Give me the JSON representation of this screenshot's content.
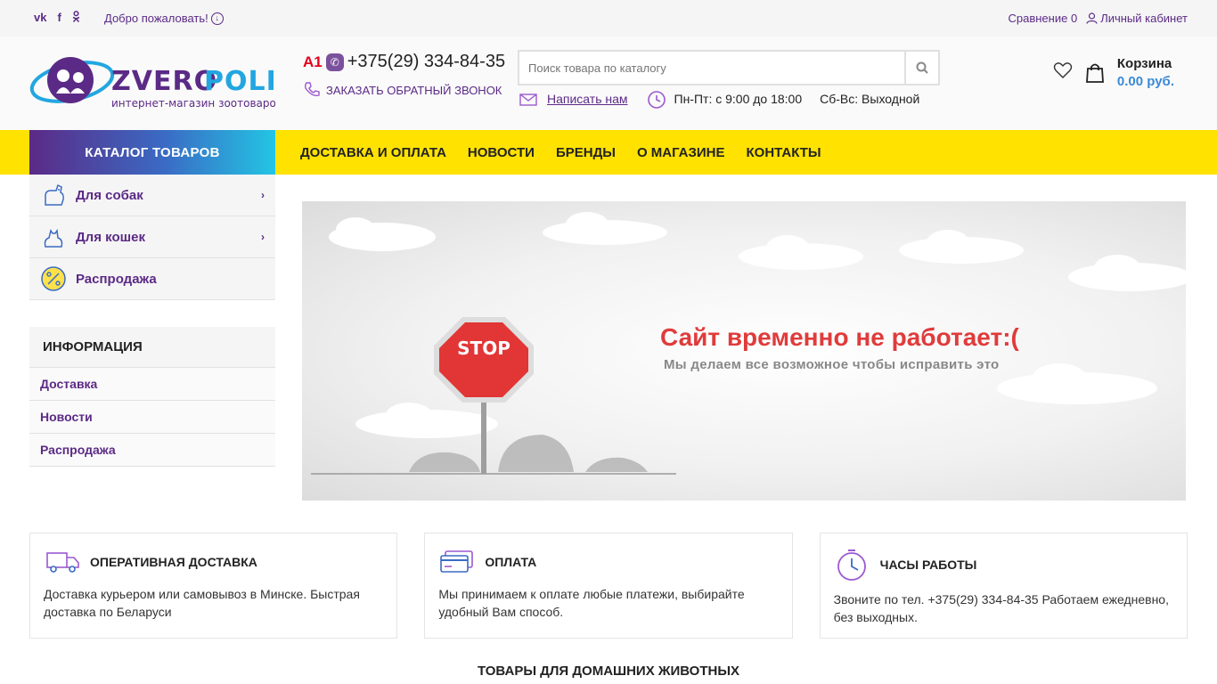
{
  "topbar": {
    "social": [
      "vk",
      "f",
      "ok"
    ],
    "welcome": "Добро пожаловать!",
    "compare": "Сравнение 0",
    "account": "Личный кабинет"
  },
  "header": {
    "logo_text": "ZVEROPOLIS",
    "logo_tagline": "интернет-магазин зоотоваров",
    "phone_prefix": "A1",
    "phone": "+375(29) 334-84-35",
    "callback": "Заказать обратный звонок",
    "search_placeholder": "Поиск товара по каталогу",
    "write_us": "Написать нам",
    "hours_weekdays": "Пн-Пт: с 9:00 до 18:00",
    "hours_weekend": "Сб-Вс: Выходной",
    "cart_title": "Корзина",
    "cart_sum": "0.00 руб."
  },
  "nav": {
    "catalog": "КАТАЛОГ ТОВАРОВ",
    "links": [
      "ДОСТАВКА И ОПЛАТА",
      "НОВОСТИ",
      "БРЕНДЫ",
      "О МАГАЗИНЕ",
      "КОНТАКТЫ"
    ]
  },
  "sidebar": {
    "categories": [
      {
        "label": "Для собак",
        "icon": "dog-icon"
      },
      {
        "label": "Для кошек",
        "icon": "cat-icon"
      },
      {
        "label": "Распродажа",
        "icon": "percent-icon"
      }
    ],
    "info_title": "ИНФОРМАЦИЯ",
    "info_items": [
      "Доставка",
      "Новости",
      "Распродажа"
    ]
  },
  "banner": {
    "stop": "STOP",
    "title": "Сайт временно не работает:(",
    "subtitle": "Мы делаем все возможное чтобы исправить это"
  },
  "features": [
    {
      "title": "ОПЕРАТИВНАЯ ДОСТАВКА",
      "text": "Доставка курьером или самовывоз в Минске. Быстрая доставка по Беларуси",
      "icon": "truck-icon"
    },
    {
      "title": "ОПЛАТА",
      "text": "Мы принимаем к оплате любые платежи, выбирайте удобный Вам способ.",
      "icon": "card-icon"
    },
    {
      "title": "ЧАСЫ РАБОТЫ",
      "text": "Звоните по тел. +375(29) 334-84-35 Работаем ежедневно, без выходных.",
      "icon": "clock-icon"
    }
  ],
  "section_title": "ТОВАРЫ ДЛЯ ДОМАШНИХ ЖИВОТНЫХ",
  "colors": {
    "brand": "#5b2a86",
    "nav": "#ffe200",
    "accent": "#3a8ad6"
  }
}
